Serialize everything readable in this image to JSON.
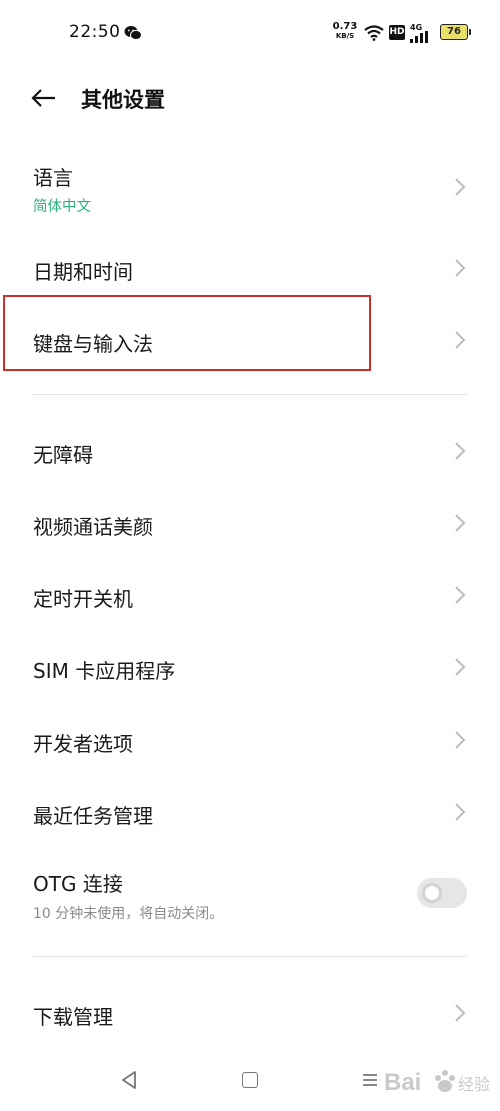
{
  "status_bar": {
    "time": "22:50",
    "net_speed_value": "0.73",
    "net_speed_unit": "KB/S",
    "hd_label": "HD",
    "network_type": "4G",
    "battery": "76",
    "icons": [
      "wechat-icon",
      "wifi-icon",
      "signal-icon",
      "battery-icon"
    ]
  },
  "header": {
    "title": "其他设置",
    "back_icon": "arrow-left-icon"
  },
  "items": [
    {
      "title": "语言",
      "subtitle": "简体中文"
    },
    {
      "title": "日期和时间"
    },
    {
      "title": "键盘与输入法"
    },
    {
      "title": "无障碍"
    },
    {
      "title": "视频通话美颜"
    },
    {
      "title": "定时开关机"
    },
    {
      "title": "SIM 卡应用程序"
    },
    {
      "title": "开发者选项"
    },
    {
      "title": "最近任务管理"
    },
    {
      "title": "OTG 连接",
      "subtitle": "10 分钟未使用，将自动关闭。",
      "toggle_on": false
    },
    {
      "title": "下载管理"
    }
  ],
  "colors": {
    "accent": "#2fb37e",
    "highlight_border": "#c9302c",
    "chevron": "#bdbdbd"
  },
  "nav_bar": {
    "icons": [
      "nav-back-icon",
      "nav-home-icon",
      "nav-menu-icon"
    ]
  },
  "watermark": {
    "text": "Bai 经验",
    "icon": "baidu-paw-logo"
  }
}
